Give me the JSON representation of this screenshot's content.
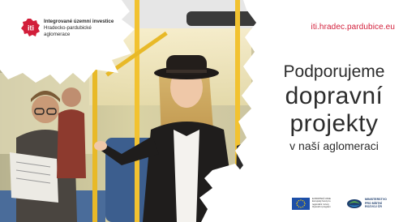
{
  "logo": {
    "icon": "iti-logo-mark",
    "mark_text": "iti",
    "line1": "Integrované územní investice",
    "line2": "Hradecko-pardubické",
    "line3": "aglomerace"
  },
  "url": "iti.hradec.pardubice.eu",
  "headline": {
    "line1": "Podporujeme",
    "line2": "dopravní",
    "line3": "projekty",
    "line4": "v naší aglomeraci"
  },
  "footer": {
    "eu_text_line1": "EVROPSKÁ UNIE",
    "eu_text_line2": "Evropský fond pro",
    "eu_text_line3": "regionální rozvoj",
    "eu_text_line4": "Operační program",
    "mmr_text_line1": "MINISTERSTVO",
    "mmr_text_line2": "PRO MÍSTNÍ",
    "mmr_text_line3": "ROZVOJ ČR"
  },
  "colors": {
    "brand_red": "#d21e3a",
    "headline": "#2c2c2c",
    "eu_blue": "#1d4fa8",
    "eu_star": "#ffd200",
    "bus_yellow": "#f2c230"
  }
}
